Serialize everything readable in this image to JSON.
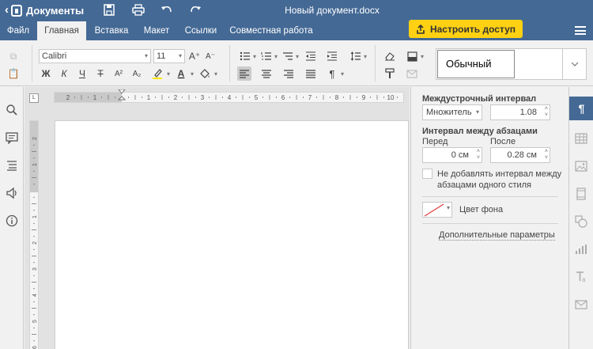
{
  "app": {
    "back_label": "Документы",
    "doc_title": "Новый документ.docx"
  },
  "tabs": [
    {
      "label": "Файл"
    },
    {
      "label": "Главная"
    },
    {
      "label": "Вставка"
    },
    {
      "label": "Макет"
    },
    {
      "label": "Ссылки"
    },
    {
      "label": "Совместная работа"
    }
  ],
  "share_label": "Настроить доступ",
  "toolbar": {
    "font_name": "Calibri",
    "font_size": "11",
    "bold": "Ж",
    "italic": "К",
    "underline": "Ч",
    "strike": "Т",
    "superscript": "A²",
    "subscript": "A₂",
    "grow": "A⁺",
    "shrink": "A⁻",
    "style_name": "Обычный"
  },
  "ruler": {
    "h_labels": [
      "2",
      "1",
      "",
      "1",
      "2",
      "3",
      "4",
      "5",
      "6",
      "7",
      "8",
      "9",
      "10"
    ],
    "v_labels": [
      "2",
      "1",
      "",
      "1",
      "2",
      "3",
      "4",
      "5",
      "6"
    ]
  },
  "panel": {
    "line_spacing_title": "Междустрочный интервал",
    "line_spacing_mode": "Множитель",
    "line_spacing_value": "1.08",
    "para_spacing_title": "Интервал между абзацами",
    "before_label": "Перед",
    "after_label": "После",
    "before_value": "0 см",
    "after_value": "0.28 см",
    "no_spacing_label_1": "Не добавлять интервал между",
    "no_spacing_label_2": "абзацами одного стиля",
    "bg_color_label": "Цвет фона",
    "advanced_link": "Дополнительные параметры"
  },
  "colors": {
    "header": "#446995",
    "accent": "#ffd112",
    "page": "#ffffff"
  }
}
